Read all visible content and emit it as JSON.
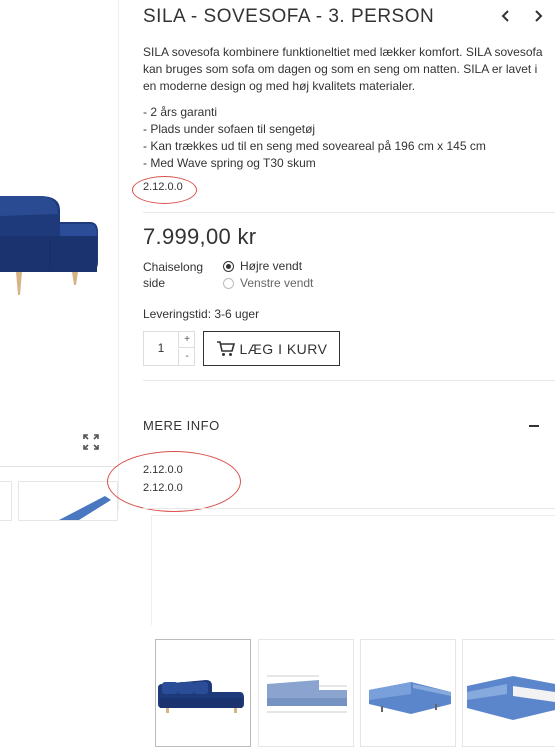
{
  "product": {
    "title": "SILA - SOVESOFA - 3. PERSON",
    "description": "SILA sovesofa kombinere funktioneltiet med lækker komfort. SILA sovesofa kan bruges som sofa om dagen og som en seng om natten. SILA er lavet i en moderne design og med høj kvalitets materialer.",
    "features": [
      "- 2 års garanti",
      "- Plads under sofaen til sengetøj",
      "- Kan trækkes ud til en seng med soveareal på 196 cm x 145 cm",
      "- Med Wave spring og T30 skum"
    ],
    "version_code": "2.12.0.0",
    "price": "7.999,00 kr",
    "option": {
      "label_line1": "Chaiselong",
      "label_line2": "side",
      "choices": [
        {
          "label": "Højre vendt",
          "selected": true
        },
        {
          "label": "Venstre vendt",
          "selected": false
        }
      ]
    },
    "delivery": "Leveringstid: 3-6 uger",
    "quantity": "1",
    "qty_plus": "+",
    "qty_minus": "-",
    "add_to_cart": "LÆG I KURV"
  },
  "more_info": {
    "heading": "MERE INFO",
    "codes": [
      "2.12.0.0",
      "2.12.0.0"
    ]
  },
  "icons": {
    "prev": "chevron-left-icon",
    "next": "chevron-right-icon",
    "expand": "expand-icon",
    "cart": "cart-icon",
    "collapse": "minus-icon"
  },
  "colors": {
    "sofa_blue": "#1f3a7a",
    "highlight_red": "#d9534f",
    "text": "#333333"
  }
}
